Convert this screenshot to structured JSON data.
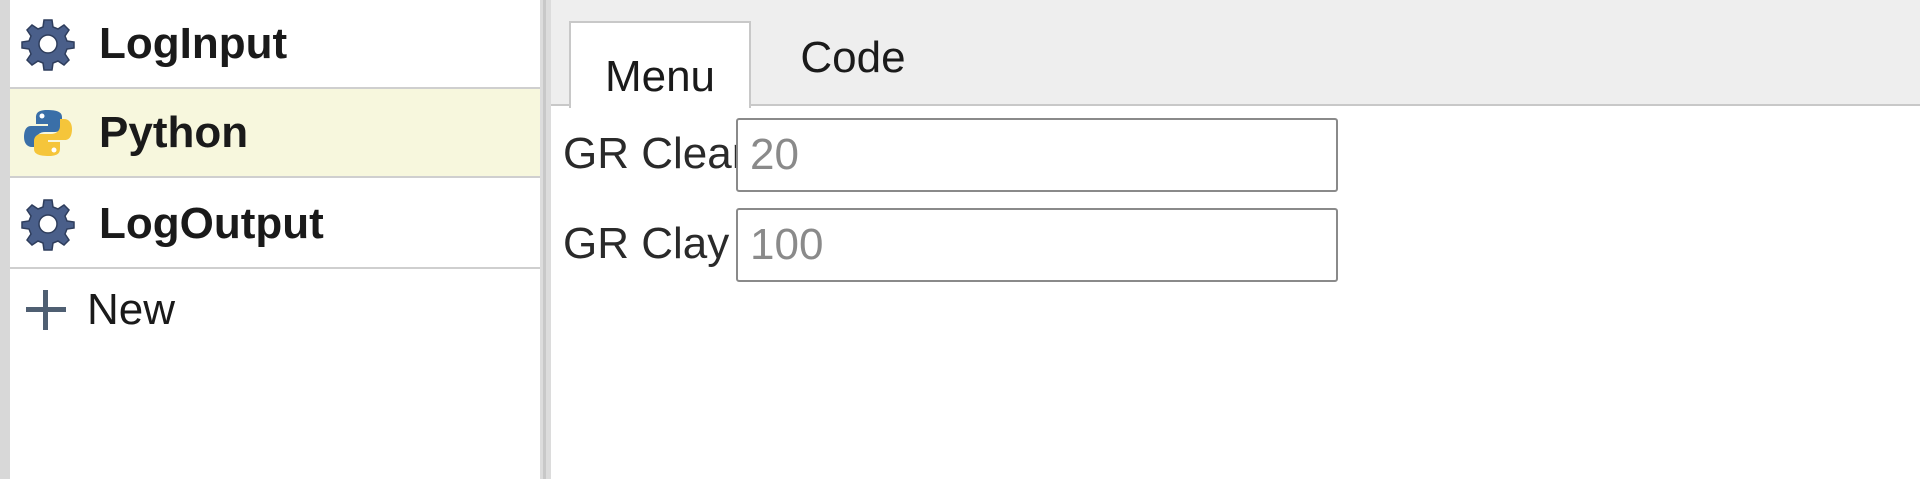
{
  "sidebar": {
    "items": [
      {
        "label": "LogInput",
        "icon": "gear-icon",
        "selected": false
      },
      {
        "label": "Python",
        "icon": "python-icon",
        "selected": true
      },
      {
        "label": "LogOutput",
        "icon": "gear-icon",
        "selected": false
      }
    ],
    "new_label": "New"
  },
  "tabs": [
    {
      "label": "Menu",
      "active": true
    },
    {
      "label": "Code",
      "active": false
    }
  ],
  "form": {
    "fields": [
      {
        "label": "GR Clean",
        "placeholder": "20"
      },
      {
        "label": "GR Clay",
        "placeholder": "100"
      }
    ]
  },
  "colors": {
    "selected_item_bg": "#f7f7dd",
    "gear_icon": "#4a5f8a",
    "python_blue": "#3a6fa8",
    "python_yellow": "#f5c53a"
  }
}
